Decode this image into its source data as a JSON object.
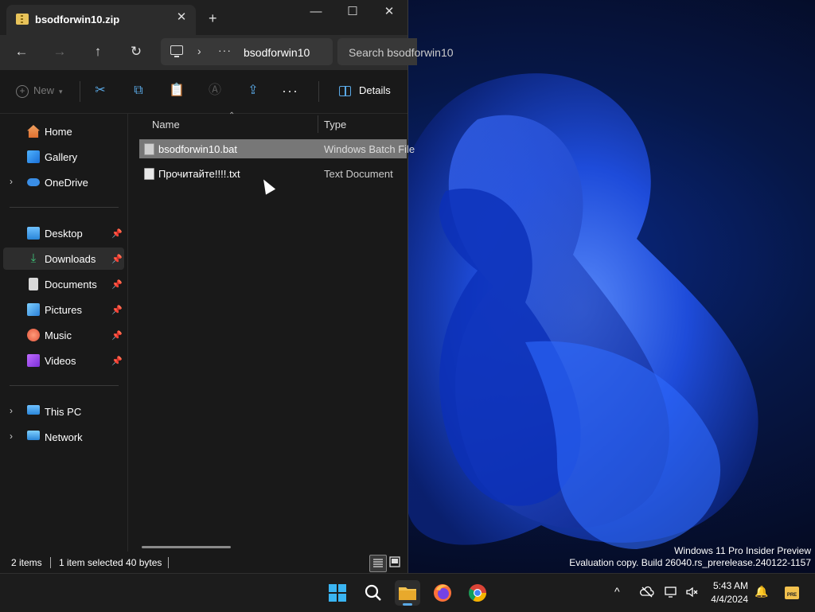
{
  "window": {
    "tab_title": "bsodforwin10.zip",
    "tab_close": "✕",
    "new_tab": "+",
    "minimize": "—",
    "maximize": "☐",
    "close": "✕"
  },
  "nav": {
    "back": "←",
    "forward": "→",
    "up": "↑",
    "refresh": "↻",
    "address_chevron": "›",
    "address_more": "···",
    "address_path": "bsodforwin10",
    "search_placeholder": "Search bsodforwin10"
  },
  "toolbar": {
    "new_label": "New",
    "more": "···",
    "details_label": "Details"
  },
  "sidebar": {
    "items": [
      {
        "label": "Home",
        "icon": "home-icon"
      },
      {
        "label": "Gallery",
        "icon": "gallery-icon"
      },
      {
        "label": "OneDrive",
        "icon": "onedrive-icon"
      },
      {
        "label": "Desktop",
        "icon": "desktop-icon"
      },
      {
        "label": "Downloads",
        "icon": "downloads-icon"
      },
      {
        "label": "Documents",
        "icon": "documents-icon"
      },
      {
        "label": "Pictures",
        "icon": "pictures-icon"
      },
      {
        "label": "Music",
        "icon": "music-icon"
      },
      {
        "label": "Videos",
        "icon": "videos-icon"
      },
      {
        "label": "This PC",
        "icon": "this-pc-icon"
      },
      {
        "label": "Network",
        "icon": "network-icon"
      }
    ]
  },
  "filelist": {
    "columns": [
      "Name",
      "Type"
    ],
    "rows": [
      {
        "name": "bsodforwin10.bat",
        "type": "Windows Batch File",
        "selected": true
      },
      {
        "name": "Прочитайте!!!!.txt",
        "type": "Text Document",
        "selected": false
      }
    ]
  },
  "status": {
    "items": "2 items",
    "selection": "1 item selected  40 bytes"
  },
  "desktop": {
    "watermark_line1": "Windows 11 Pro Insider Preview",
    "watermark_line2": "Evaluation copy. Build 26040.rs_prerelease.240122-1157"
  },
  "taskbar": {
    "time": "5:43 AM",
    "date": "4/4/2024",
    "tray_chevron": "^",
    "pre_badge": "PRE"
  },
  "colors": {
    "accent": "#5aa9e6",
    "selected_row": "#777777",
    "window_bg": "#191919"
  }
}
